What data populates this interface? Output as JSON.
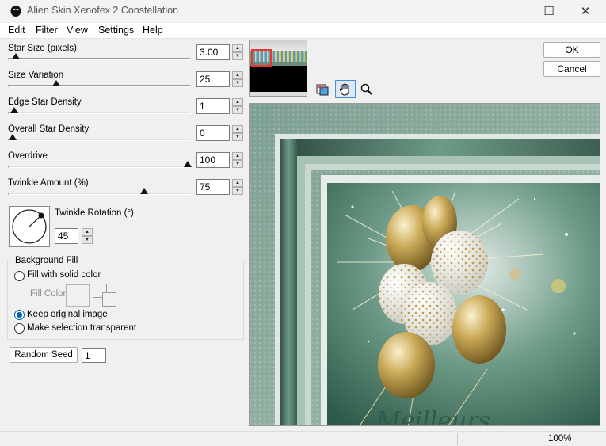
{
  "window": {
    "title": "Alien Skin Xenofex 2 Constellation",
    "maximize_glyph": "☐",
    "close_glyph": "✕"
  },
  "menu": [
    "Edit",
    "Filter",
    "View",
    "Settings",
    "Help"
  ],
  "sliders": [
    {
      "label": "Star Size (pixels)",
      "value": "3.00",
      "fraction": 0.02
    },
    {
      "label": "Size Variation",
      "value": "25",
      "fraction": 0.25
    },
    {
      "label": "Edge Star Density",
      "value": "1",
      "fraction": 0.01
    },
    {
      "label": "Overall Star Density",
      "value": "0",
      "fraction": 0.0
    },
    {
      "label": "Overdrive",
      "value": "100",
      "fraction": 1.0
    },
    {
      "label": "Twinkle Amount (%)",
      "value": "75",
      "fraction": 0.75
    }
  ],
  "twinkle_rotation": {
    "label": "Twinkle Rotation (°)",
    "value": "45"
  },
  "background_fill": {
    "title": "Background Fill",
    "solid_color_label": "Fill with solid color",
    "fill_color_label": "Fill Color",
    "keep_original_label": "Keep original image",
    "transparent_label": "Make selection transparent",
    "selected": "keep_original"
  },
  "random_seed": {
    "label": "Random Seed",
    "value": "1"
  },
  "buttons": {
    "ok": "OK",
    "cancel": "Cancel"
  },
  "status": {
    "zoom": "100%"
  },
  "preview_text": "Meilleurs"
}
